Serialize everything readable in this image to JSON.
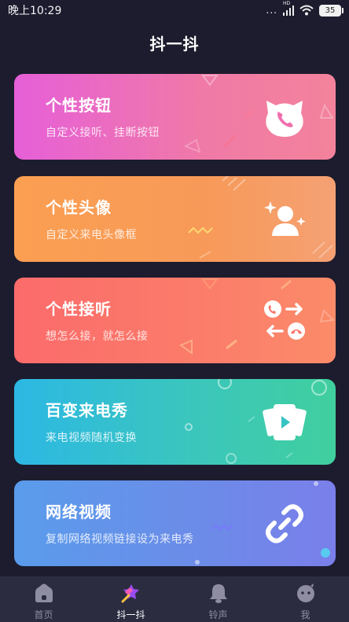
{
  "status": {
    "time": "晚上10:29",
    "dots": "...",
    "hd": "HD",
    "battery": "35"
  },
  "header": {
    "title": "抖一抖"
  },
  "cards": [
    {
      "title": "个性按钮",
      "subtitle": "自定义接听、挂断按钮",
      "icon": "cat-phone-icon"
    },
    {
      "title": "个性头像",
      "subtitle": "自定义来电头像框",
      "icon": "sparkle-person-icon"
    },
    {
      "title": "个性接听",
      "subtitle": "想怎么接，就怎么接",
      "icon": "answer-hangup-icon"
    },
    {
      "title": "百变来电秀",
      "subtitle": "来电视频随机变换",
      "icon": "video-cards-icon"
    },
    {
      "title": "网络视频",
      "subtitle": "复制网络视频链接设为来电秀",
      "icon": "link-icon"
    }
  ],
  "tabs": [
    {
      "label": "首页",
      "icon": "home-icon",
      "active": false
    },
    {
      "label": "抖一抖",
      "icon": "magic-wand-icon",
      "active": true
    },
    {
      "label": "铃声",
      "icon": "bell-icon",
      "active": false
    },
    {
      "label": "我",
      "icon": "profile-face-icon",
      "active": false
    }
  ],
  "colors": {
    "background": "#1d1c2e",
    "tab_bar": "#2c2c41",
    "card_button": "#e65fd8",
    "card_avatar": "#fb9f52",
    "card_answer": "#fb6b6b",
    "card_show": "#2cb8e4",
    "card_video": "#5a9cec"
  }
}
